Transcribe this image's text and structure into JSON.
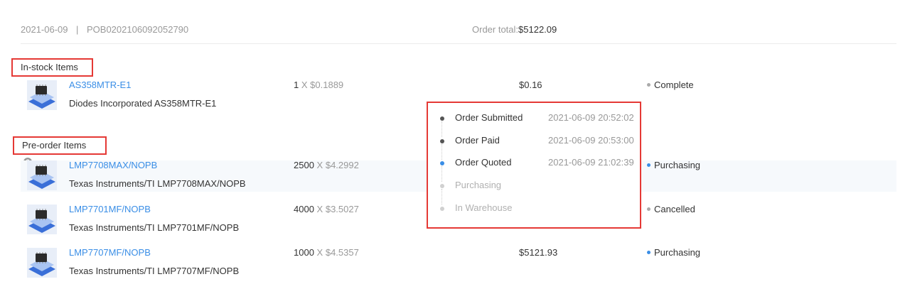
{
  "order": {
    "date": "2021-06-09",
    "separator": "|",
    "number": "POB0202106092052790",
    "total_label": "Order total:",
    "total_value": "$5122.09"
  },
  "sections": {
    "instock_label": "In-stock Items",
    "preorder_label": "Pre-order Items"
  },
  "instock_items": [
    {
      "part": "AS358MTR-E1",
      "desc": "Diodes Incorporated AS358MTR-E1",
      "qty": "1",
      "x": "X",
      "price": "$0.1889",
      "subtotal": "$0.16",
      "status": "Complete",
      "status_color": "#aaaaaa"
    }
  ],
  "preorder_items": [
    {
      "part": "LMP7708MAX/NOPB",
      "desc": "Texas Instruments/TI LMP7708MAX/NOPB",
      "qty": "2500",
      "x": "X",
      "price": "$4.2992",
      "subtotal": "",
      "status": "Purchasing",
      "status_color": "#3a8ee6"
    },
    {
      "part": "LMP7701MF/NOPB",
      "desc": "Texas Instruments/TI LMP7701MF/NOPB",
      "qty": "4000",
      "x": "X",
      "price": "$3.5027",
      "subtotal": "",
      "status": "Cancelled",
      "status_color": "#aaaaaa"
    },
    {
      "part": "LMP7707MF/NOPB",
      "desc": "Texas Instruments/TI LMP7707MF/NOPB",
      "qty": "1000",
      "x": "X",
      "price": "$4.5357",
      "subtotal": "$5121.93",
      "status": "Purchasing",
      "status_color": "#3a8ee6"
    }
  ],
  "timeline": [
    {
      "name": "Order Submitted",
      "time": "2021-06-09 20:52:02",
      "state": "done",
      "dot_color": "#555555",
      "text_color": "#333333"
    },
    {
      "name": "Order Paid",
      "time": "2021-06-09 20:53:00",
      "state": "done",
      "dot_color": "#555555",
      "text_color": "#333333"
    },
    {
      "name": "Order Quoted",
      "time": "2021-06-09 21:02:39",
      "state": "current",
      "dot_color": "#3a8ee6",
      "text_color": "#333333"
    },
    {
      "name": "Purchasing",
      "time": "",
      "state": "pending",
      "dot_color": "#d0d0d0",
      "text_color": "#b0b0b0"
    },
    {
      "name": "In Warehouse",
      "time": "",
      "state": "pending",
      "dot_color": "#d0d0d0",
      "text_color": "#b0b0b0"
    }
  ],
  "icons": {
    "help": "question-circle-icon",
    "thumb": "chip-thumbnail-icon"
  }
}
